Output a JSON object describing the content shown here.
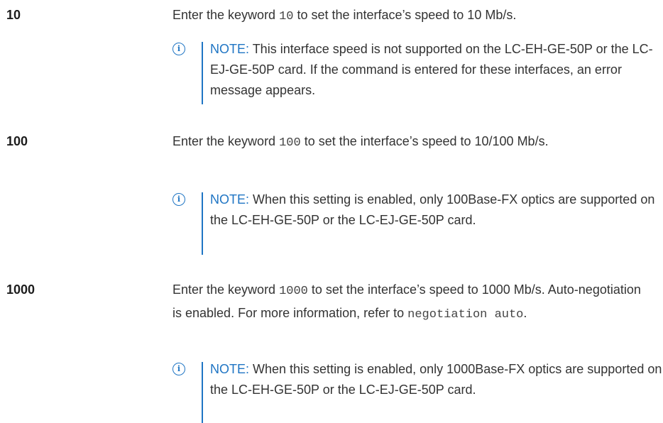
{
  "entries": [
    {
      "term": "10",
      "desc_pre": "Enter the keyword ",
      "desc_code": "10",
      "desc_post": " to set the interface’s speed to 10 Mb/s.",
      "note_label": "NOTE:",
      "note_text": " This interface speed is not supported on the LC-EH-GE-50P or the LC-EJ-GE-50P card. If the command is entered for these interfaces, an error message appears."
    },
    {
      "term": "100",
      "desc_pre": "Enter the keyword ",
      "desc_code": "100",
      "desc_post": " to set the interface’s speed to 10/100 Mb/s.",
      "note_label": "NOTE:",
      "note_text": " When this setting is enabled, only 100Base-FX optics are supported on the LC-EH-GE-50P or the LC-EJ-GE-50P card."
    },
    {
      "term": "1000",
      "desc_pre": "Enter the keyword ",
      "desc_code": "1000",
      "desc_post": " to set the interface’s speed to 1000 Mb/s. Auto-negotiation is enabled. For more information, refer to ",
      "desc_code2": "negotiation auto",
      "desc_end": ".",
      "note_label": "NOTE:",
      "note_text": " When this setting is enabled, only 1000Base-FX optics are supported on the LC-EH-GE-50P or the LC-EJ-GE-50P card."
    }
  ],
  "icons": {
    "note_icon": "info-circle-icon",
    "accent_color": "#1f75c4"
  }
}
